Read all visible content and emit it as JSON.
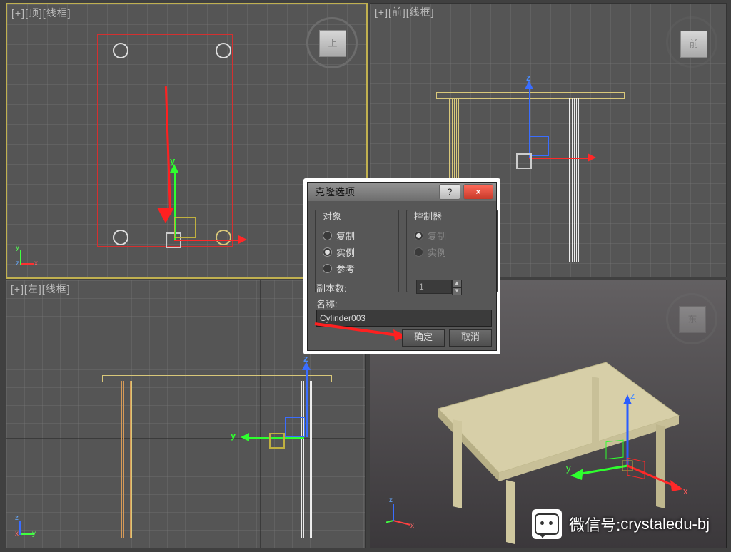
{
  "viewports": {
    "top_label": "[+][顶][线框]",
    "front_label": "[+][前][线框]",
    "left_label": "[+][左][线框]",
    "persp_label": "",
    "cube_top": "上",
    "cube_front": "前",
    "cube_persp": "东"
  },
  "gizmo": {
    "x": "x",
    "y": "y",
    "z": "z"
  },
  "dialog": {
    "title": "克隆选项",
    "help": "?",
    "close": "×",
    "object_caption": "对象",
    "object_options": [
      "复制",
      "实例",
      "参考"
    ],
    "object_selected": 1,
    "controller_caption": "控制器",
    "controller_options": [
      "复制",
      "实例"
    ],
    "controller_selected": 0,
    "copies_label": "副本数:",
    "copies_value": "1",
    "name_label": "名称:",
    "name_value": "Cylinder003",
    "ok": "确定",
    "cancel": "取消"
  },
  "watermark": {
    "prefix": "微信号: ",
    "id": "crystaledu-bj"
  }
}
